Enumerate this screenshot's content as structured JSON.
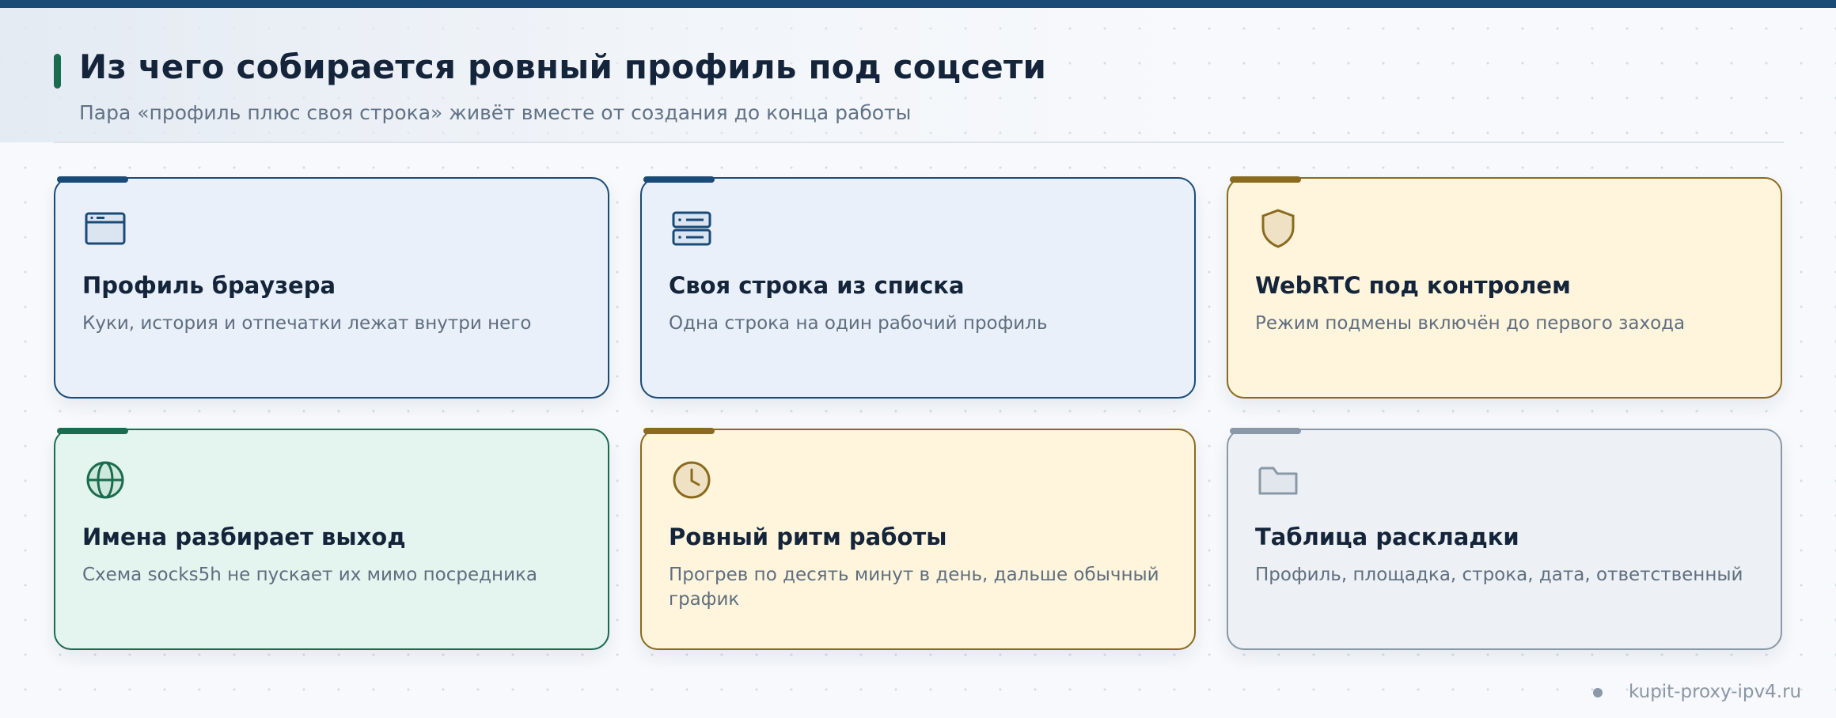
{
  "header": {
    "title": "Из чего собирается ровный профиль под соцсети",
    "subtitle": "Пара «профиль плюс своя строка» живёт вместе от создания до конца работы"
  },
  "cards": [
    {
      "icon": "browser-window-icon",
      "title": "Профиль браузера",
      "description": "Куки, история и отпечатки лежат внутри него",
      "color": "#1a4a76"
    },
    {
      "icon": "server-list-icon",
      "title": "Своя строка из списка",
      "description": "Одна строка на один рабочий профиль",
      "color": "#1a4a76"
    },
    {
      "icon": "shield-icon",
      "title": "WebRTC под контролем",
      "description": "Режим подмены включён до первого захода",
      "color": "#8a6a1e"
    },
    {
      "icon": "globe-icon",
      "title": "Имена разбирает выход",
      "description": "Схема socks5h не пускает их мимо посредника",
      "color": "#1b6b4f"
    },
    {
      "icon": "clock-icon",
      "title": "Ровный ритм работы",
      "description": "Прогрев по десять минут в день, дальше обычный график",
      "color": "#8a6a1e"
    },
    {
      "icon": "folder-icon",
      "title": "Таблица раскладки",
      "description": "Профиль, площадка, строка, дата, ответственный",
      "color": "#8b98a7"
    }
  ],
  "footer": {
    "site": "kupit-proxy-ipv4.ru"
  },
  "colors": {
    "top_bar": "#1a4a76",
    "title_accent": "#1b6b4f",
    "blue": "#1a4a76",
    "amber": "#8a6a1e",
    "green": "#1b6b4f",
    "gray": "#8b98a7"
  }
}
